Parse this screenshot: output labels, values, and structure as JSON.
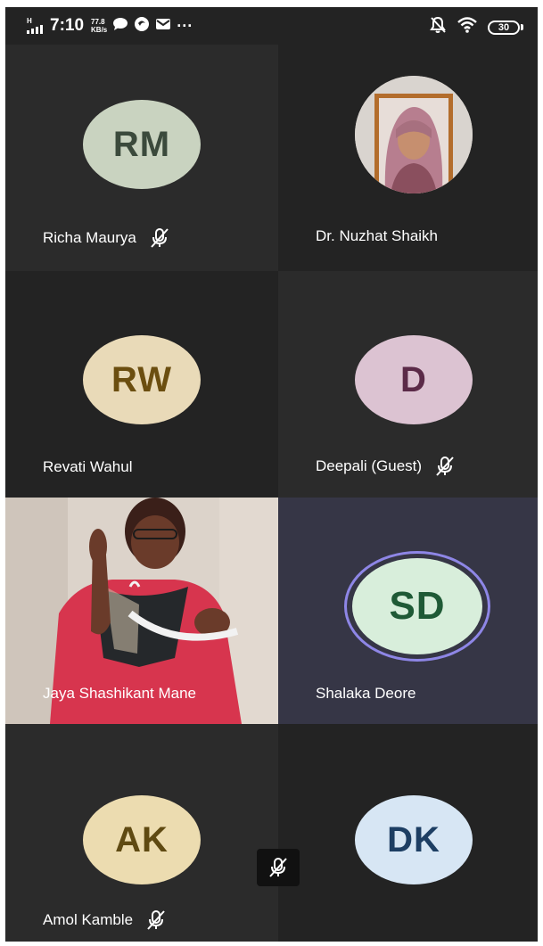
{
  "status_bar": {
    "network": "H",
    "time": "7:10",
    "speed_value": "77.8",
    "speed_unit": "KB/s",
    "more": "···",
    "battery": "30",
    "icons": [
      "signal-icon",
      "chat-bubble-icon",
      "vpn-app-icon",
      "mail-icon",
      "notifications-off-icon",
      "wifi-icon",
      "battery-icon"
    ]
  },
  "participants": [
    {
      "initials": "RM",
      "name": "Richa Maurya",
      "muted": true,
      "avatar_bg": "#c9d3c0",
      "avatar_fg": "#3b4a3c"
    },
    {
      "initials": "",
      "name": "Dr. Nuzhat Shaikh",
      "muted": false,
      "has_photo": true
    },
    {
      "initials": "RW",
      "name": "Revati Wahul",
      "muted": false,
      "avatar_bg": "#e9dab8",
      "avatar_fg": "#6b4e10"
    },
    {
      "initials": "D",
      "name": "Deepali (Guest)",
      "muted": true,
      "avatar_bg": "#dcc3d2",
      "avatar_fg": "#5b2a48"
    },
    {
      "initials": "",
      "name": "Jaya Shashikant Mane",
      "muted": false,
      "has_video": true
    },
    {
      "initials": "SD",
      "name": "Shalaka Deore",
      "muted": false,
      "speaking": true,
      "avatar_bg": "#d8eedb",
      "avatar_fg": "#1f5a36"
    },
    {
      "initials": "AK",
      "name": "Amol Kamble",
      "muted": true,
      "avatar_bg": "#ecdcb0",
      "avatar_fg": "#5f4a12"
    },
    {
      "initials": "DK",
      "name": "",
      "muted": false,
      "avatar_bg": "#d7e6f4",
      "avatar_fg": "#1d3e63"
    }
  ],
  "colors": {
    "tile_dark": "#2b2b2b",
    "tile_darker": "#232323",
    "speaking_tile": "#363646",
    "speaking_ring": "#8e86e6"
  }
}
